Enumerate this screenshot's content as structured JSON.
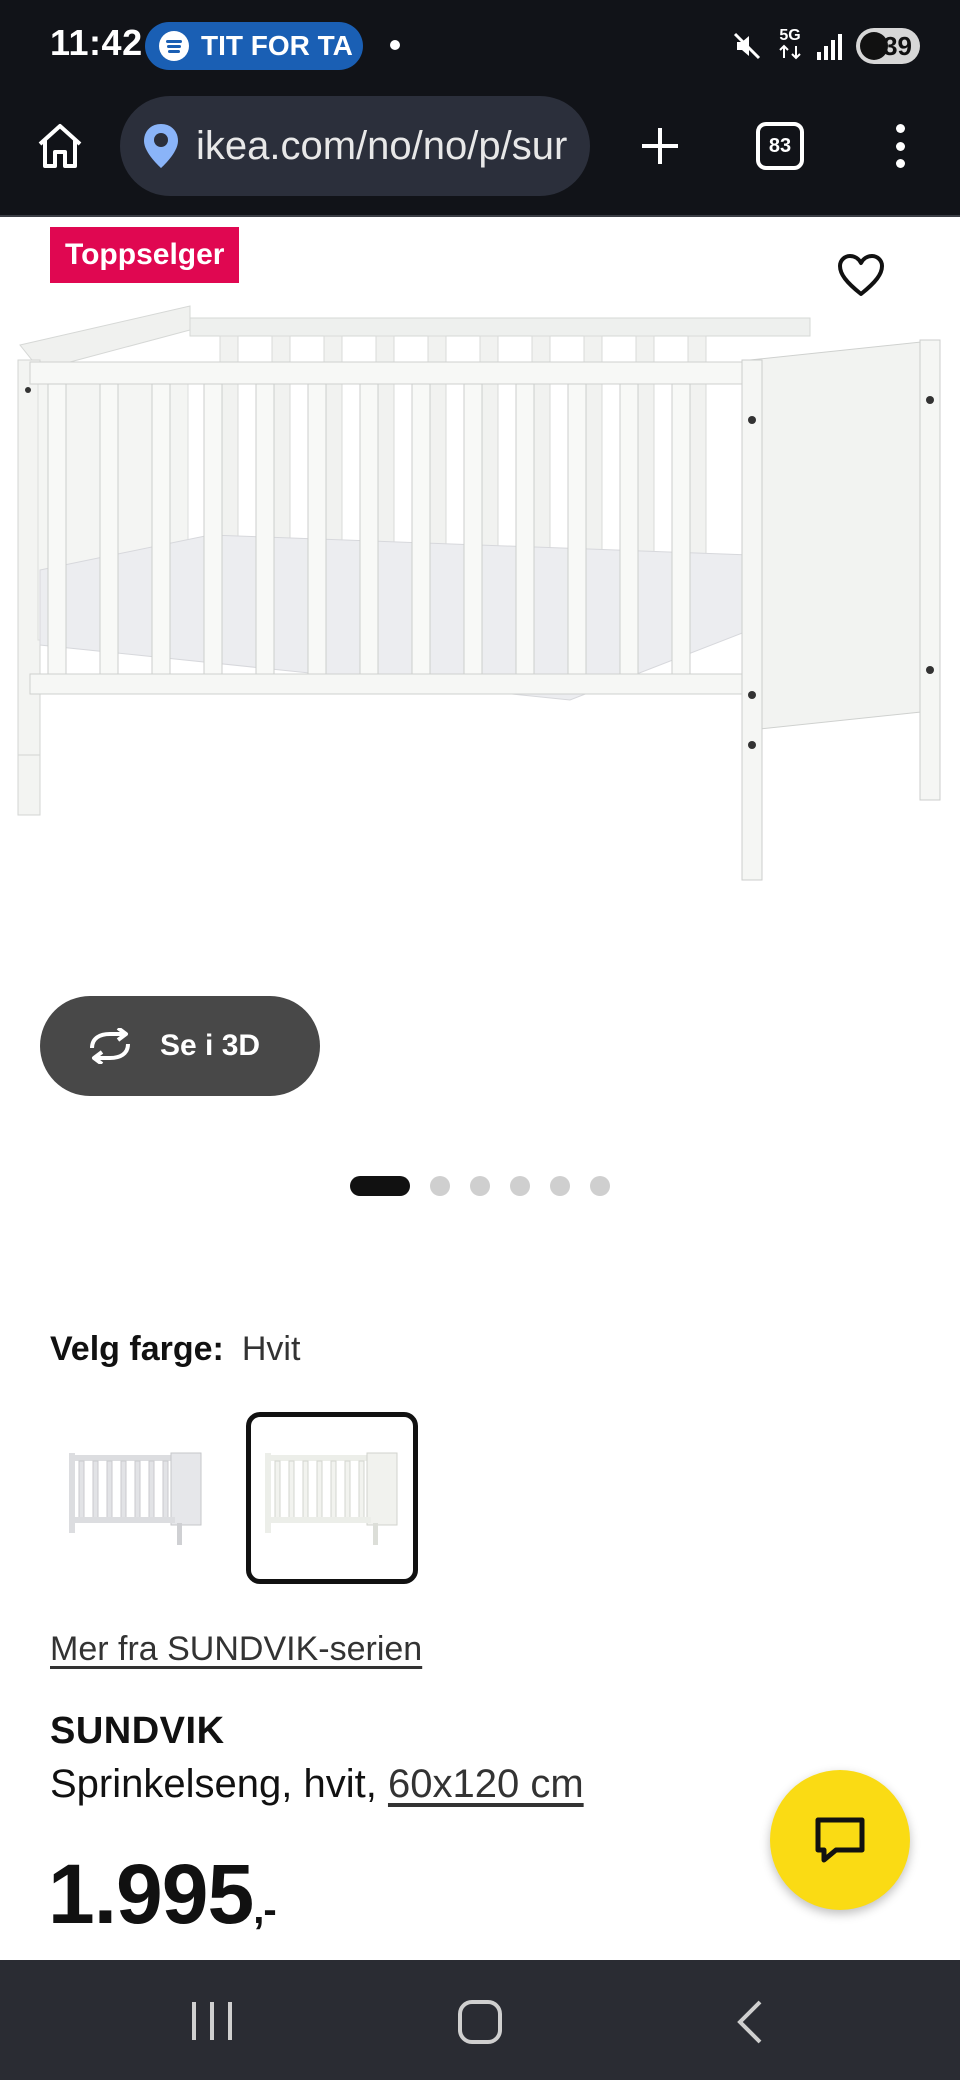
{
  "status_bar": {
    "time": "11:42",
    "media_text": "TIT FOR TA",
    "network_label": "5G",
    "battery_level": "39"
  },
  "browser": {
    "url": "ikea.com/no/no/p/sur",
    "tab_count": "83"
  },
  "product": {
    "badge": "Toppselger",
    "view_3d_label": "Se i 3D",
    "gallery_total": 6,
    "gallery_active_index": 0,
    "color_label": "Velg farge:",
    "color_value": "Hvit",
    "series_link": "Mer fra SUNDVIK-serien",
    "name": "SUNDVIK",
    "description": "Sprinkelseng, hvit,",
    "size_link": "60x120 cm",
    "price": "1.995",
    "price_suffix": ",-"
  },
  "colors": {
    "badge_bg": "#e00751",
    "chat_button": "#fadb14",
    "dark_bar": "#111318",
    "nav_bar": "#2a2c33"
  }
}
